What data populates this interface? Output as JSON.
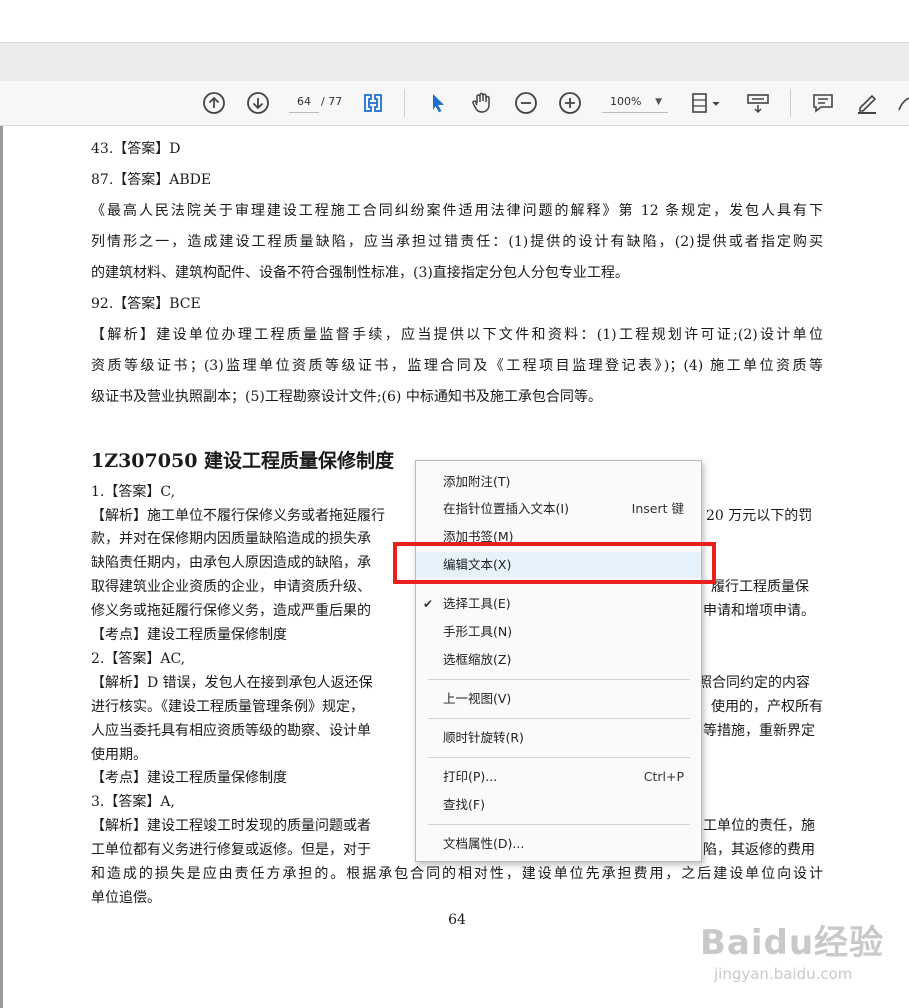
{
  "toolbar": {
    "page_current": "64",
    "page_total": "/ 77",
    "zoom": "100%"
  },
  "document": {
    "lines": [
      "43.【答案】D",
      "87.【答案】ABDE",
      "《最高人民法院关于审理建设工程施工合同纠纷案件适用法律问题的解释》第 12 条规定，发包人具有下",
      "列情形之一，造成建设工程质量缺陷，应当承担过错责任：(1)提供的设计有缺陷，(2)提供或者指定购买",
      "的建筑材料、建筑构配件、设备不符合强制性标准，(3)直接指定分包人分包专业工程。",
      "92.【答案】BCE",
      "【解析】建设单位办理工程质量监督手续，应当提供以下文件和资料：(1)工程规划许可证;(2)设计单位",
      "资质等级证书；(3)监理单位资质等级证书，监理合同及《工程项目监理登记表》)；(4) 施工单位资质等",
      "级证书及营业执照副本；(5)工程勘察设计文件;(6) 中标通知书及施工承包合同等。"
    ],
    "heading": "1Z307050  建设工程质量保修制度",
    "lines2": [
      "1.【答案】C,",
      "【解析】施工单位不履行保修义务或者拖延履行",
      "20 万元以下的罚",
      "款，并对在保修期内因质量缺陷造成的损失承",
      "缺陷责任期内，由承包人原因造成的缺陷，承",
      "取得建筑业企业资质的企业，申请资质升级、",
      "履行工程质量保",
      "修义务或拖延履行保修义务，造成严重后果的",
      "申请和增项申请。",
      "【考点】建设工程质量保修制度",
      "2.【答案】AC,",
      "【解析】D 错误，发包人在接到承包人返还保",
      "照合同约定的内容",
      "进行核实。《建设工程质量管理条例》规定，",
      "使用的，产权所有",
      "人应当委托具有相应资质等级的勘察、设计单",
      "等措施，重新界定",
      "使用期。",
      "【考点】建设工程质量保修制度",
      "3.【答案】A,",
      "【解析】建设工程竣工时发现的质量问题或者",
      "工单位的责任，施",
      "工单位都有义务进行修复或返修。但是，对于",
      "陷，其返修的费用",
      "和造成的损失是应由责任方承担的。根据承包合同的相对性，建设单位先承担费用，之后建设单位向设计",
      "单位追偿。"
    ],
    "page_number": "64"
  },
  "context_menu": {
    "items": [
      {
        "label": "添加附注(T)",
        "shortcut": ""
      },
      {
        "label": "在指针位置插入文本(I)",
        "shortcut": "Insert 键"
      },
      {
        "label": "添加书签(M)",
        "shortcut": ""
      },
      {
        "label": "编辑文本(X)",
        "shortcut": ""
      },
      {
        "label": "选择工具(E)",
        "shortcut": ""
      },
      {
        "label": "手形工具(N)",
        "shortcut": ""
      },
      {
        "label": "选框缩放(Z)",
        "shortcut": ""
      },
      {
        "label": "上一视图(V)",
        "shortcut": ""
      },
      {
        "label": "顺时针旋转(R)",
        "shortcut": ""
      },
      {
        "label": "打印(P)...",
        "shortcut": "Ctrl+P"
      },
      {
        "label": "查找(F)",
        "shortcut": ""
      },
      {
        "label": "文档属性(D)...",
        "shortcut": ""
      }
    ],
    "checked_mark": "✔"
  },
  "watermark": {
    "brand": "Baidu经验",
    "url": "jingyan.baidu.com"
  },
  "colors": {
    "highlight_box": "#e8201e",
    "menu_hover": "#e5f1fb",
    "toolbar_blue": "#1f6fd1"
  },
  "icons": [
    "arrow-up-circle-icon",
    "arrow-down-circle-icon",
    "fit-page-icon",
    "select-arrow-icon",
    "hand-icon",
    "zoom-out-icon",
    "zoom-in-icon",
    "page-layout-icon",
    "scroll-mode-icon",
    "comment-icon",
    "highlight-pen-icon",
    "draw-icon"
  ]
}
